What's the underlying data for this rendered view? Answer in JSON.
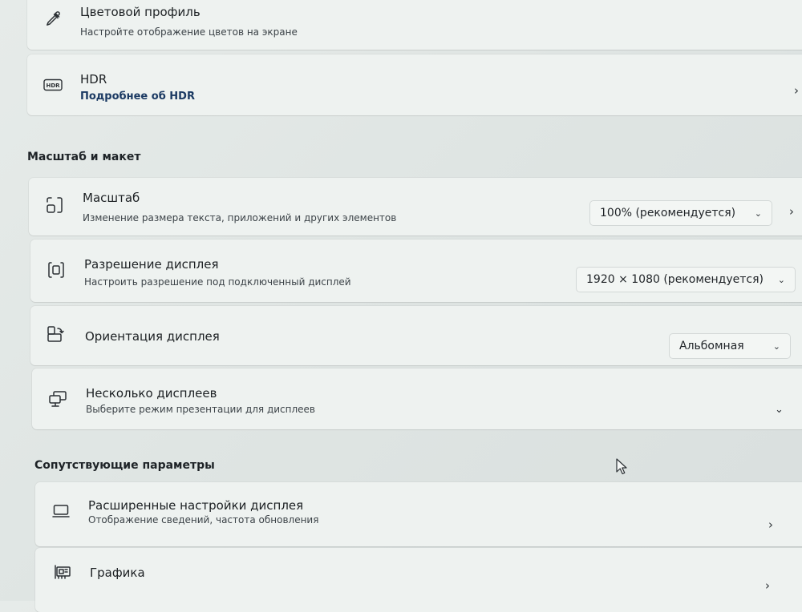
{
  "color_profile": {
    "title": "Цветовой профиль",
    "subtitle": "Настройте отображение цветов на экране"
  },
  "hdr": {
    "badge": "HDR",
    "title": "HDR",
    "link": "Подробнее об HDR"
  },
  "scale_layout": {
    "heading": "Масштаб и макет",
    "scale": {
      "title": "Масштаб",
      "subtitle": "Изменение размера текста, приложений и других элементов",
      "value": "100% (рекомендуется)"
    },
    "resolution": {
      "title": "Разрешение дисплея",
      "subtitle": "Настроить разрешение под подключенный дисплей",
      "value": "1920 × 1080 (рекомендуется)"
    },
    "orientation": {
      "title": "Ориентация дисплея",
      "value": "Альбомная"
    },
    "multiple": {
      "title": "Несколько дисплеев",
      "subtitle": "Выберите режим презентации для дисплеев"
    }
  },
  "related": {
    "heading": "Сопутствующие параметры",
    "advanced": {
      "title": "Расширенные настройки дисплея",
      "subtitle": "Отображение сведений, частота обновления"
    },
    "graphics": {
      "title": "Графика"
    }
  },
  "icons": {
    "color_profile": "eyedropper-icon",
    "hdr": "hdr-icon",
    "scale": "scale-icon",
    "resolution": "resolution-icon",
    "orientation": "orientation-icon",
    "multiple": "multiple-displays-icon",
    "advanced": "monitor-icon",
    "graphics": "graphics-card-icon",
    "chevron": "chevron-right-icon",
    "dropdown": "chevron-down-icon"
  }
}
